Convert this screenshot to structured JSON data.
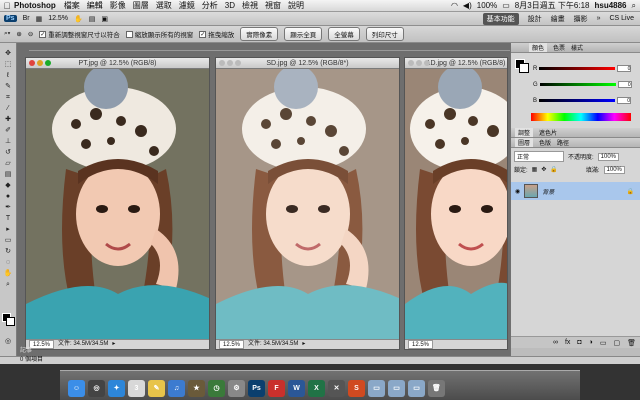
{
  "menubar": {
    "apple": "",
    "app_name": "Photoshop",
    "items": [
      "檔案",
      "編輯",
      "影像",
      "圖層",
      "選取",
      "濾鏡",
      "分析",
      "3D",
      "檢視",
      "視窗",
      "說明"
    ],
    "battery": "100%",
    "datetime": "8月3日週五 下午6:18",
    "user": "hsu4886"
  },
  "appbar": {
    "ps_label": "Ps",
    "zoom": "12.5%",
    "workspaces": [
      "基本功能",
      "設計",
      "繪畫",
      "攝影"
    ],
    "active_workspace": "基本功能",
    "cs_live": "CS Live"
  },
  "options": {
    "check1": "重新調整視窗尺寸以符合",
    "check2": "縮放顯示所有的視窗",
    "check3": "拖曳縮放",
    "btn_actual": "實際像素",
    "btn_fit": "顯示全頁",
    "btn_fill": "全螢幕",
    "btn_print": "列印尺寸"
  },
  "documents": [
    {
      "title": "PT.jpg @ 12.5% (RGB/8)",
      "zoom": "12.5%",
      "file": "文件: 34.5M/34.5M",
      "tone": "vivid"
    },
    {
      "title": "SD.jpg @ 12.5% (RGB/8*)",
      "zoom": "12.5%",
      "file": "文件: 34.5M/34.5M",
      "tone": "soft"
    },
    {
      "title": "1D.jpg @ 12.5% (RGB/8)",
      "zoom": "12.5%",
      "file": "",
      "tone": "bright"
    }
  ],
  "panels": {
    "color_tabs": [
      "顏色",
      "色票",
      "樣式"
    ],
    "sliders": [
      {
        "label": "R",
        "value": "0"
      },
      {
        "label": "G",
        "value": "0"
      },
      {
        "label": "B",
        "value": "0"
      }
    ],
    "adjust_tabs": [
      "調整",
      "遮色片"
    ],
    "layers_tabs": [
      "圖層",
      "色版",
      "路徑"
    ],
    "blend_mode": "正常",
    "opacity_label": "不透明度:",
    "opacity": "100%",
    "lock_label": "鎖定:",
    "fill_label": "填滿:",
    "fill": "100%",
    "layer_name": "背景"
  },
  "statusbar": {
    "text": "記事",
    "items_label": "0 個項目"
  },
  "dock": {
    "icons": [
      {
        "name": "finder",
        "label": "☺",
        "color": "#3b8ee8"
      },
      {
        "name": "dashboard",
        "label": "◎",
        "color": "#444"
      },
      {
        "name": "safari",
        "label": "✦",
        "color": "#2d86d9"
      },
      {
        "name": "calendar",
        "label": "3",
        "color": "#d8d8d8"
      },
      {
        "name": "notes",
        "label": "✎",
        "color": "#e8c44a"
      },
      {
        "name": "itunes",
        "label": "♫",
        "color": "#3c7bd0"
      },
      {
        "name": "imovie",
        "label": "★",
        "color": "#6a5a3a"
      },
      {
        "name": "timemachine",
        "label": "◷",
        "color": "#3a7a3a"
      },
      {
        "name": "preferences",
        "label": "⚙",
        "color": "#888"
      },
      {
        "name": "photoshop",
        "label": "Ps",
        "color": "#0b3f6e"
      },
      {
        "name": "filezilla",
        "label": "F",
        "color": "#c9302c"
      },
      {
        "name": "word",
        "label": "W",
        "color": "#2b5797"
      },
      {
        "name": "excel",
        "label": "X",
        "color": "#217346"
      },
      {
        "name": "tools",
        "label": "✕",
        "color": "#555"
      },
      {
        "name": "app-s",
        "label": "S",
        "color": "#d04a20"
      },
      {
        "name": "folder1",
        "label": "▭",
        "color": "#8aa8c8"
      },
      {
        "name": "folder2",
        "label": "▭",
        "color": "#8aa8c8"
      },
      {
        "name": "folder3",
        "label": "▭",
        "color": "#8aa8c8"
      },
      {
        "name": "trash",
        "label": "🗑",
        "color": "#777"
      }
    ]
  },
  "colors": {
    "accent": "#0b3f6e",
    "layer_selected": "#a9c7ec",
    "teal_shirt": "#4aa9b4"
  }
}
